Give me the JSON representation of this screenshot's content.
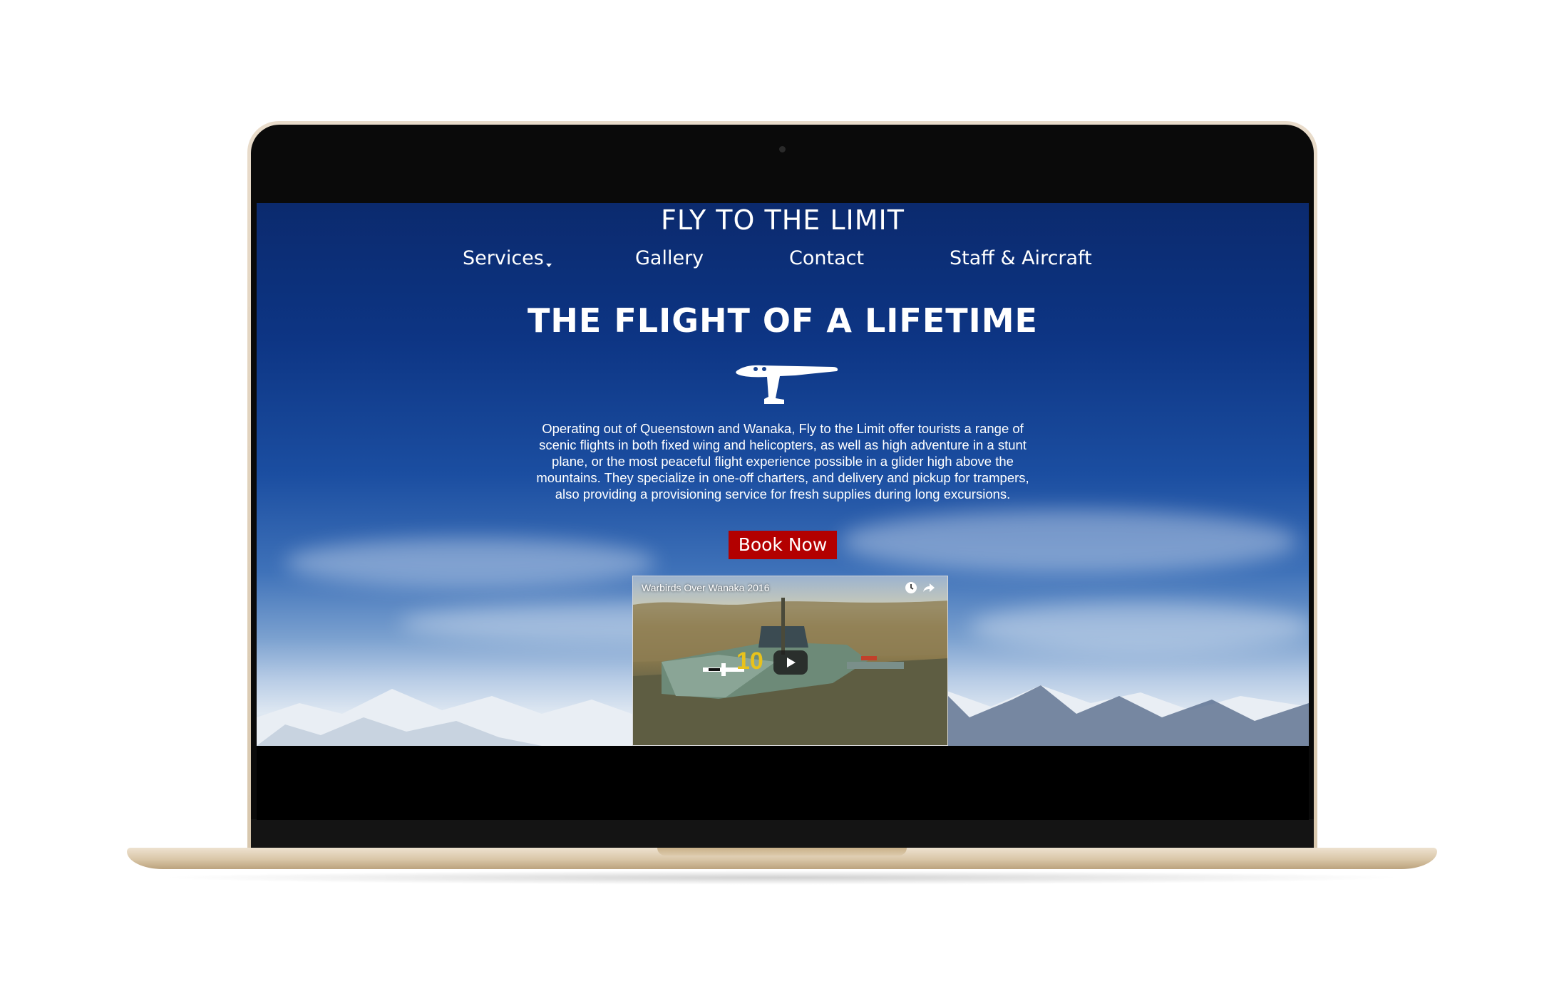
{
  "site": {
    "title": "FLY TO THE LIMIT",
    "nav": {
      "services": "Services",
      "gallery": "Gallery",
      "contact": "Contact",
      "staff": "Staff & Aircraft"
    },
    "headline": "THE FLIGHT OF A LIFETIME",
    "description": "Operating out of Queenstown and Wanaka, Fly to the Limit offer tourists a range of scenic flights in both fixed wing and helicopters, as well as high adventure in a stunt plane, or the most peaceful flight experience possible in a glider high above the mountains. They specialize in one-off charters, and delivery and pickup for trampers, also providing a provisioning service for fresh supplies during long excursions.",
    "book_button": "Book Now",
    "video": {
      "title": "Warbirds Over Wanaka 2016",
      "icons": [
        "clock-icon",
        "share-icon",
        "play-icon"
      ]
    }
  },
  "colors": {
    "sky_top": "#0b2a6e",
    "book_button": "#b30000",
    "text": "#ffffff",
    "laptop_gold": "#d8c7ad"
  },
  "icons": [
    "plane-icon",
    "dropdown-caret-icon",
    "camera-icon"
  ]
}
